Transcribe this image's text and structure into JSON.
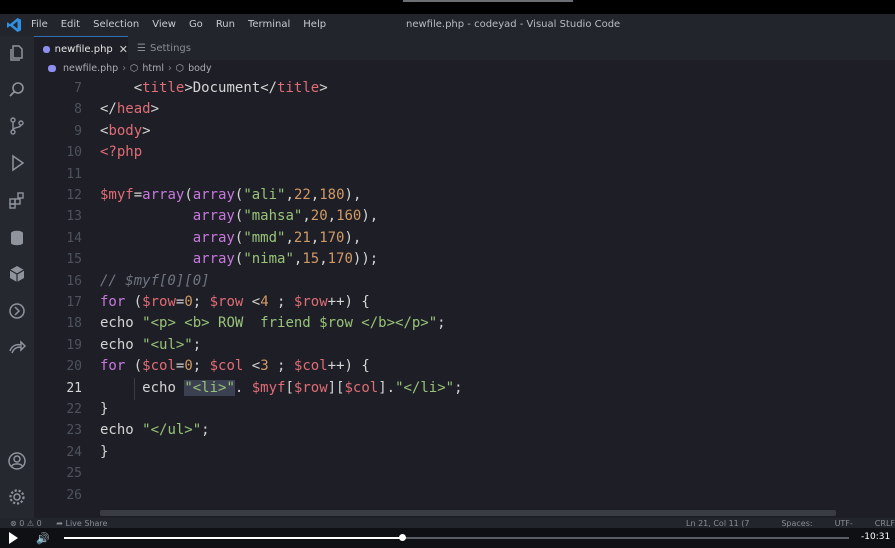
{
  "window": {
    "title": "newfile.php - codeyad - Visual Studio Code"
  },
  "menu": [
    "File",
    "Edit",
    "Selection",
    "View",
    "Go",
    "Run",
    "Terminal",
    "Help"
  ],
  "activity_bar": {
    "icons": [
      "explorer-icon",
      "search-icon",
      "source-control-icon",
      "run-debug-icon",
      "extensions-icon",
      "database-icon",
      "package-icon",
      "remote-icon",
      "live-share-icon",
      "account-icon",
      "gear-icon"
    ]
  },
  "tabs": [
    {
      "label": "newfile.php",
      "active": true
    },
    {
      "label": "Settings",
      "active": false
    }
  ],
  "breadcrumb": [
    "newfile.php",
    "html",
    "body"
  ],
  "editor": {
    "current_line": 21,
    "lines": [
      {
        "n": "7",
        "text": "    <title>Document</title>"
      },
      {
        "n": "8",
        "text": "</head>"
      },
      {
        "n": "9",
        "text": "<body>"
      },
      {
        "n": "10",
        "text": "<?php"
      },
      {
        "n": "11",
        "text": ""
      },
      {
        "n": "12",
        "text": "$myf=array(array(\"ali\",22,180),"
      },
      {
        "n": "13",
        "text": "           array(\"mahsa\",20,160),"
      },
      {
        "n": "14",
        "text": "           array(\"mmd\",21,170),"
      },
      {
        "n": "15",
        "text": "           array(\"nima\",15,170));"
      },
      {
        "n": "16",
        "text": "// $myf[0][0]"
      },
      {
        "n": "17",
        "text": "for ($row=0; $row <4 ; $row++) {"
      },
      {
        "n": "18",
        "text": "echo \"<p> <b> ROW  friend $row </b></p>\";"
      },
      {
        "n": "19",
        "text": "echo \"<ul>\";"
      },
      {
        "n": "20",
        "text": "for ($col=0; $col <3 ; $col++) {"
      },
      {
        "n": "21",
        "text": "     echo \"<li>\". $myf[$row][$col].\"</li>\";"
      },
      {
        "n": "22",
        "text": "}"
      },
      {
        "n": "23",
        "text": "echo \"</ul>\";"
      },
      {
        "n": "24",
        "text": "}"
      },
      {
        "n": "25",
        "text": ""
      },
      {
        "n": "26",
        "text": ""
      }
    ]
  },
  "statusbar": {
    "problems": "⊗ 0 ⚠ 0",
    "live_share": "Live Share",
    "position": "Ln 21, Col 11 (7 selected)",
    "spaces": "Spaces: 4",
    "encoding": "UTF-8",
    "eol": "CRLF"
  },
  "player": {
    "time": "-10:31",
    "progress": 0.43
  },
  "colors": {
    "accent": "#2f6fb1",
    "string": "#98c379",
    "keyword": "#c678dd",
    "variable": "#e06c75",
    "number": "#d19a66"
  }
}
